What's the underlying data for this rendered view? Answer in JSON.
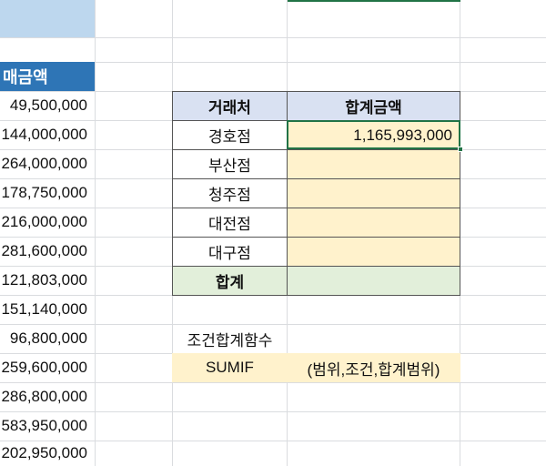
{
  "colors": {
    "header_blue": "#2e75b6",
    "light_blue": "#bdd7ee",
    "table_header": "#d9e1f2",
    "input_yellow": "#fff2cc",
    "total_green": "#e2efda",
    "selection_green": "#217346",
    "gridline": "#dadcdf"
  },
  "left_column": {
    "header": "매금액",
    "values": [
      "49,500,000",
      "144,000,000",
      "264,000,000",
      "178,750,000",
      "216,000,000",
      "281,600,000",
      "121,803,000",
      "151,140,000",
      "96,800,000",
      "259,600,000",
      "286,800,000",
      "583,950,000",
      "202,950,000"
    ]
  },
  "summary_table": {
    "headers": [
      "거래처",
      "합계금액"
    ],
    "rows": [
      {
        "name": "경호점",
        "amount": "1,165,993,000"
      },
      {
        "name": "부산점",
        "amount": ""
      },
      {
        "name": "청주점",
        "amount": ""
      },
      {
        "name": "대전점",
        "amount": ""
      },
      {
        "name": "대구점",
        "amount": ""
      }
    ],
    "total_label": "합계",
    "total_value": ""
  },
  "notes": {
    "label": "조건합계함수",
    "function_name": "SUMIF",
    "syntax": "(범위,조건,합계범위)"
  }
}
